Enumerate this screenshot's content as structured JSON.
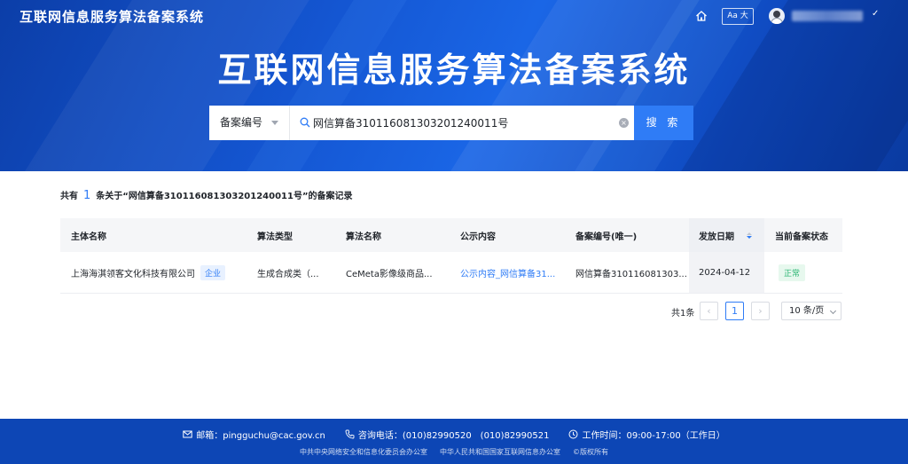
{
  "header": {
    "site_title": "互联网信息服务算法备案系统",
    "font_size_label": "Aa 大"
  },
  "hero": {
    "title": "互联网信息服务算法备案系统"
  },
  "search": {
    "field_select": "备案编号",
    "query": "网信算备310116081303201240011号",
    "button_label": "搜 索"
  },
  "results": {
    "summary_prefix": "共有",
    "count": "1",
    "summary_suffix": "条关于“网信算备310116081303201240011号”的备案记录"
  },
  "table": {
    "columns": [
      "主体名称",
      "算法类型",
      "算法名称",
      "公示内容",
      "备案编号(唯一)",
      "发放日期",
      "当前备案状态"
    ],
    "rows": [
      {
        "entity": "上海海淇领客文化科技有限公司",
        "entity_tag": "企业",
        "algo_type": "生成合成类（...",
        "algo_name": "CeMeta影像级商品...",
        "public_content": "公示内容_网信算备31...",
        "record_no": "网信算备310116081303...",
        "issue_date": "2024-04-12",
        "status": "正常"
      }
    ]
  },
  "pagination": {
    "total": "共1条",
    "current_page": "1",
    "page_size": "10 条/页"
  },
  "footer": {
    "email": "邮箱：pingguchu@cac.gov.cn",
    "phone": "咨询电话：(010)82990520　(010)82990521",
    "hours": "工作时间：09:00-17:00（工作日）",
    "org1": "中共中央网络安全和信息化委员会办公室",
    "org2": "中华人民共和国国家互联网信息办公室",
    "copyright": "©版权所有"
  },
  "colors": {
    "primary": "#2f7cf6",
    "hero_blue": "#1456d2",
    "footer_blue": "#0d46b5",
    "status_green": "#2bb673"
  },
  "icons": [
    "home-icon",
    "avatar",
    "search-icon",
    "clear-icon",
    "sort-icon",
    "mail-icon",
    "phone-icon",
    "clock-icon"
  ]
}
